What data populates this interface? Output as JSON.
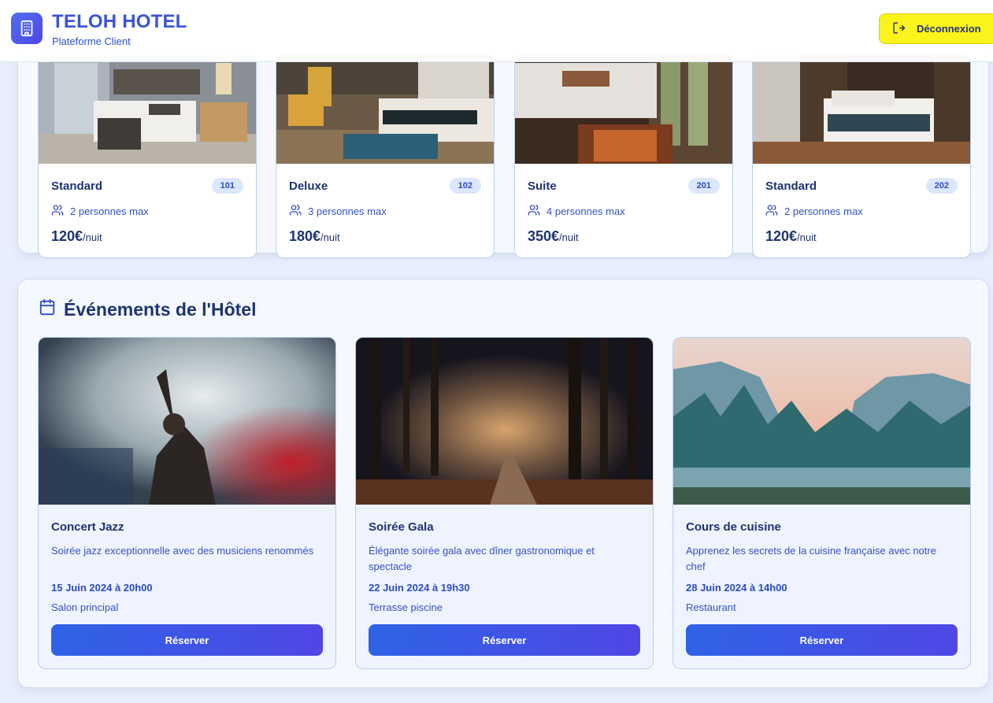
{
  "header": {
    "brand_title": "TELOH HOTEL",
    "brand_subtitle": "Plateforme Client",
    "logout_label": "Déconnexion",
    "icons": {
      "logo": "building-icon",
      "logout": "logout-icon"
    },
    "logout_color": "#fbf41a"
  },
  "rooms": [
    {
      "type": "Standard",
      "number": "101",
      "capacity": "2 personnes max",
      "price": "120€",
      "unit": "/nuit"
    },
    {
      "type": "Deluxe",
      "number": "102",
      "capacity": "3 personnes max",
      "price": "180€",
      "unit": "/nuit"
    },
    {
      "type": "Suite",
      "number": "201",
      "capacity": "4 personnes max",
      "price": "350€",
      "unit": "/nuit"
    },
    {
      "type": "Standard",
      "number": "202",
      "capacity": "2 personnes max",
      "price": "120€",
      "unit": "/nuit"
    }
  ],
  "events": {
    "title": "Événements de l'Hôtel",
    "icon": "calendar-icon",
    "button_label": "Réserver",
    "items": [
      {
        "title": "Concert Jazz",
        "description": "Soirée jazz exceptionnelle avec des musiciens renommés",
        "date": "15 Juin 2024 à 20h00",
        "place": "Salon principal"
      },
      {
        "title": "Soirée Gala",
        "description": "Élégante soirée gala avec dîner gastronomique et spectacle",
        "date": "22 Juin 2024 à 19h30",
        "place": "Terrasse piscine"
      },
      {
        "title": "Cours de cuisine",
        "description": "Apprenez les secrets de la cuisine française avec notre chef",
        "date": "28 Juin 2024 à 14h00",
        "place": "Restaurant"
      }
    ]
  },
  "colors": {
    "accent": "#4f46e5",
    "primary_text": "#1e3470",
    "button_gradient_start": "#2e63e6",
    "button_gradient_end": "#4f46e5"
  }
}
